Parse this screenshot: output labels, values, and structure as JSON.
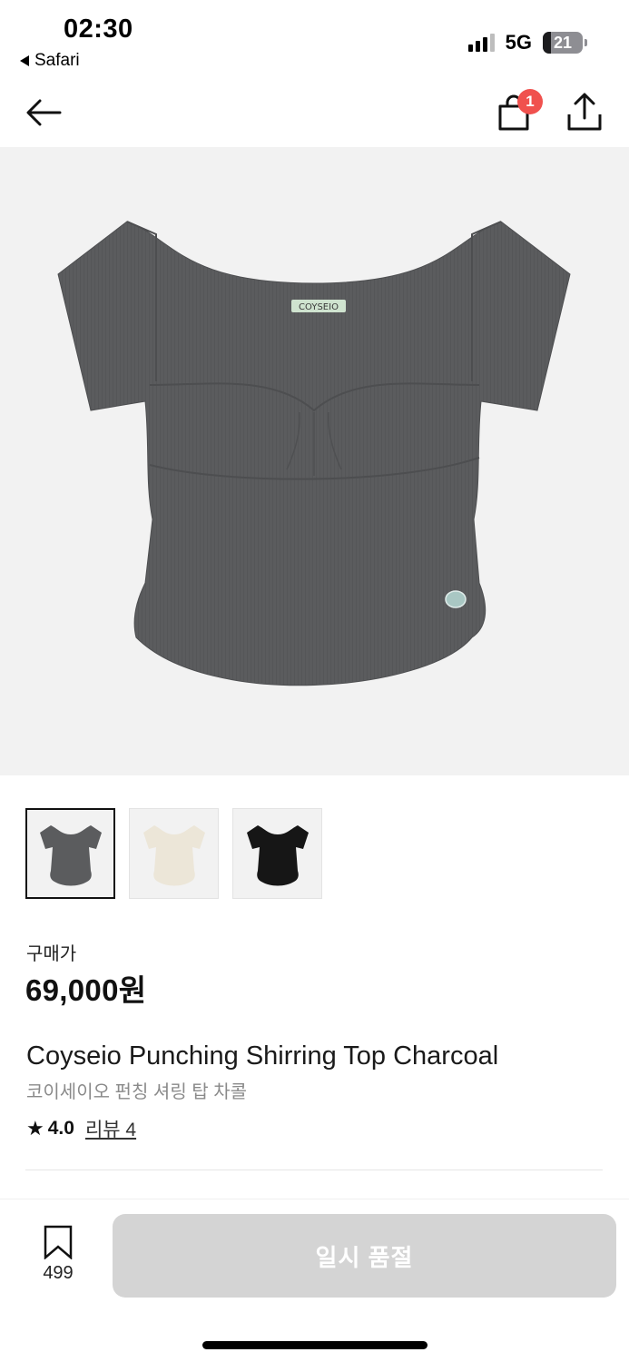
{
  "status_bar": {
    "time": "02:30",
    "back_app": "Safari",
    "network": "5G",
    "battery": "21",
    "battery_fraction": 0.21
  },
  "nav": {
    "cart_badge": "1",
    "icons": [
      "back-arrow-icon",
      "shopping-bag-icon",
      "share-icon"
    ]
  },
  "product": {
    "colors": {
      "charcoal": "#5b5c5e",
      "ivory": "#ece6d8",
      "black": "#161616",
      "label": "#cfe3cf",
      "label_text": "#3a3a3a"
    },
    "shirt_label": "COYSEIO",
    "thumbnails": [
      {
        "name": "charcoal",
        "selected": true
      },
      {
        "name": "ivory",
        "selected": false
      },
      {
        "name": "black",
        "selected": false
      }
    ],
    "price_label": "구매가",
    "price": "69,000원",
    "title_en": "Coyseio Punching Shirring Top Charcoal",
    "title_ko": "코이세이오 펀칭 셔링 탑 차콜",
    "rating_star": "★",
    "rating": "4.0",
    "reviews_label": "리뷰 4"
  },
  "bottom": {
    "wishlist_count": "499",
    "soldout_label": "일시 품절",
    "soldout_bg": "#d4d4d4"
  }
}
